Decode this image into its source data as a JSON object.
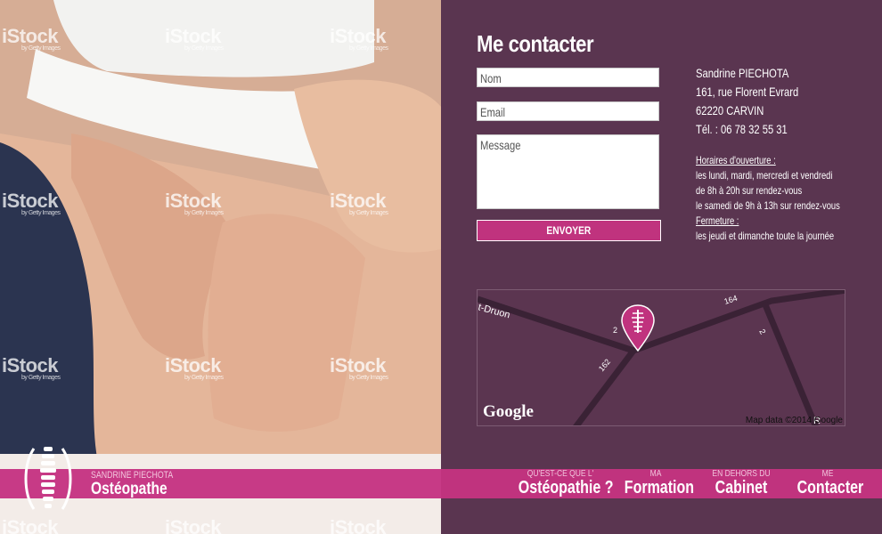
{
  "photo": {
    "watermark_text": "iStock",
    "watermark_sub": "by Getty Images"
  },
  "contact": {
    "title": "Me contacter",
    "name_placeholder": "Nom",
    "email_placeholder": "Email",
    "message_placeholder": "Message",
    "send_label": "ENVOYER"
  },
  "address": {
    "name": "Sandrine PIECHOTA",
    "street": "161, rue Florent Evrard",
    "city": "62220 CARVIN",
    "phone": "Tél. : 06 78 32 55 31"
  },
  "hours": {
    "open_title": "Horaires d'ouverture :",
    "line1": "les lundi, mardi, mercredi et vendredi",
    "line2": "de 8h à 20h sur rendez-vous",
    "line3": "le samedi de 9h à 13h sur rendez-vous",
    "closed_title": "Fermeture :",
    "closed_line": "les jeudi et dimanche toute la journée"
  },
  "map": {
    "label_druon": "t-Druon",
    "label_2a": "2",
    "label_162": "162",
    "label_164": "164",
    "label_2b": "2",
    "label_r": "R",
    "google": "Google",
    "map_data": "Map data ©2014 Google"
  },
  "brand": {
    "subtitle": "SANDRINE PIECHOTA",
    "title": "Ostéopathe"
  },
  "nav": {
    "items": [
      {
        "small": "QU'EST-CE QUE L'",
        "big": "Ostéopathie ?"
      },
      {
        "small": "MA",
        "big": "Formation"
      },
      {
        "small": "EN DEHORS DU",
        "big": "Cabinet"
      },
      {
        "small": "ME",
        "big": "Contacter"
      }
    ]
  },
  "colors": {
    "panel": "#5a3550",
    "accent": "#c0337e"
  }
}
